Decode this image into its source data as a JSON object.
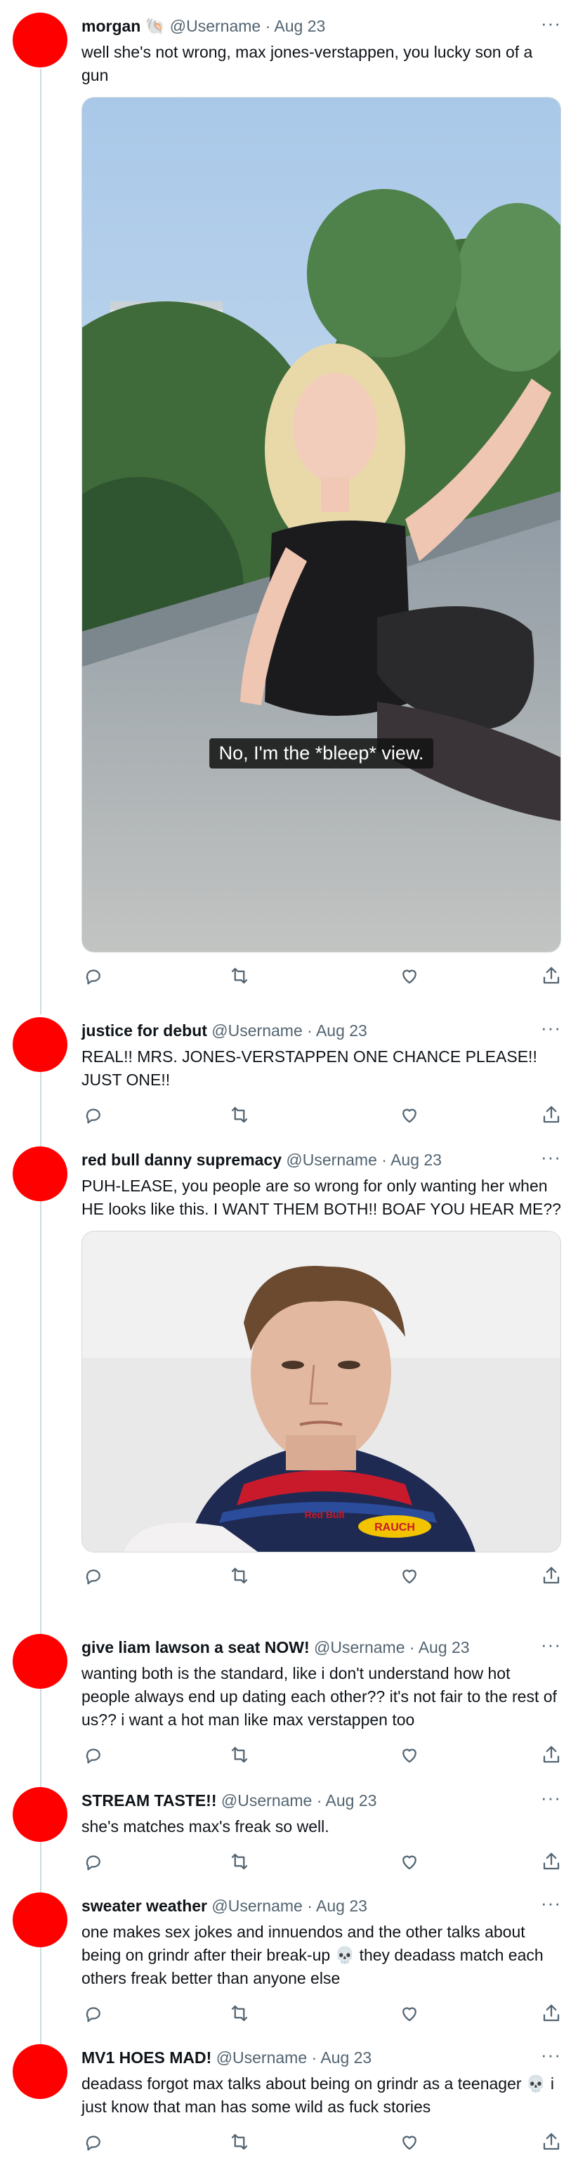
{
  "tweets": [
    {
      "name": "morgan 🐚",
      "handle": "@Username",
      "sep": "·",
      "date": "Aug 23",
      "text": "well she's not wrong, max jones-verstappen, you lucky son of a gun",
      "media_caption": "No, I'm the *bleep* view."
    },
    {
      "name": "justice for debut",
      "handle": "@Username",
      "sep": "·",
      "date": "Aug 23",
      "text": "REAL!! MRS. JONES-VERSTAPPEN ONE CHANCE PLEASE!! JUST ONE!!"
    },
    {
      "name": "red bull danny supremacy",
      "handle": "@Username",
      "sep": "·",
      "date": "Aug 23",
      "text": "PUH-LEASE, you people are so wrong for only wanting her when HE looks like this. I WANT THEM BOTH!! BOAF YOU HEAR ME??",
      "media_badges": [
        "Red Bull",
        "RAUCH"
      ]
    },
    {
      "name": "give liam lawson a seat NOW!",
      "handle": "@Username",
      "sep": "·",
      "date": "Aug 23",
      "text": "wanting both is the standard, like i don't understand how hot people always end up dating each other?? it's not fair to the rest of us?? i want a hot man like max verstappen too"
    },
    {
      "name": "STREAM TASTE!!",
      "handle": "@Username",
      "sep": "·",
      "date": "Aug 23",
      "text": "she's matches max's freak so well."
    },
    {
      "name": "sweater weather",
      "handle": "@Username",
      "sep": "·",
      "date": "Aug 23",
      "text": "one makes sex jokes and innuendos and the other talks about being on grindr after their break-up 💀 they deadass match each others freak better than anyone else"
    },
    {
      "name": "MV1 HOES MAD!",
      "handle": "@Username",
      "sep": "·",
      "date": "Aug 23",
      "text": "deadass forgot max talks about being on grindr as a teenager 💀 i just know that man has some wild as fuck stories"
    }
  ],
  "more_glyph": "···",
  "colors": {
    "avatar": "#ff0000",
    "muted": "#536471",
    "thread_line": "#cfd9de"
  },
  "icons": [
    "reply-icon",
    "retweet-icon",
    "like-icon",
    "share-icon"
  ]
}
